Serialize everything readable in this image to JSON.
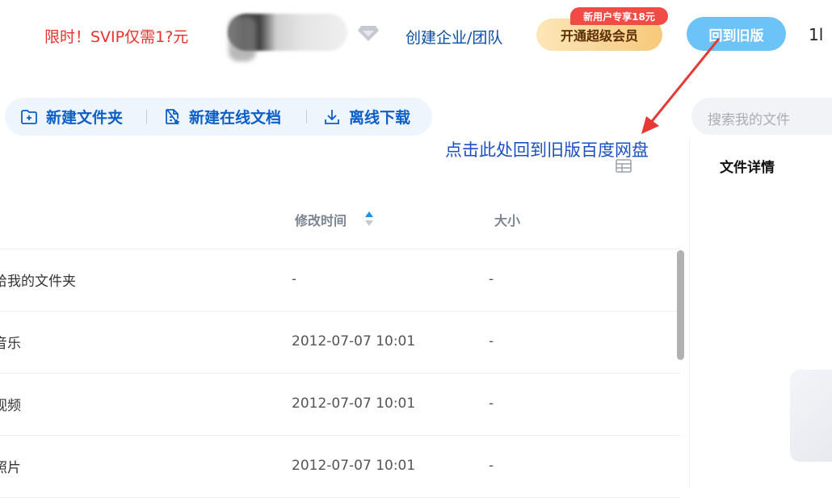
{
  "topbar": {
    "promo_text": "限时！SVIP仅需1?元",
    "create_team_label": "创建企业/团队",
    "svip_button_label": "开通超级会员",
    "svip_badge_label": "新用户专享18元",
    "old_version_button_label": "回到旧版",
    "edge_glyph": "1l"
  },
  "toolbar": {
    "new_folder_label": "新建文件夹",
    "new_online_doc_label": "新建在线文档",
    "offline_download_label": "离线下载"
  },
  "search": {
    "placeholder": "搜索我的文件"
  },
  "annotation": {
    "text": "点击此处回到旧版百度网盘"
  },
  "details_panel": {
    "title": "文件详情"
  },
  "table": {
    "columns": {
      "modified": "修改时间",
      "size": "大小"
    },
    "rows": [
      {
        "name": "给我的文件夹",
        "modified": "-",
        "size": "-"
      },
      {
        "name": "音乐",
        "modified": "2012-07-07 10:01",
        "size": "-"
      },
      {
        "name": "视频",
        "modified": "2012-07-07 10:01",
        "size": "-"
      },
      {
        "name": "照片",
        "modified": "2012-07-07 10:01",
        "size": "-"
      }
    ]
  },
  "colors": {
    "accent_blue": "#0d5fc7",
    "promo_red": "#e8322c",
    "annotation_blue": "#1b4fc4",
    "arrow_red": "#e53935",
    "old_button_blue": "#6cc3f7"
  },
  "icons": [
    "diamond-icon",
    "new-folder-icon",
    "new-doc-icon",
    "download-icon",
    "view-toggle-icon",
    "sort-icon"
  ]
}
